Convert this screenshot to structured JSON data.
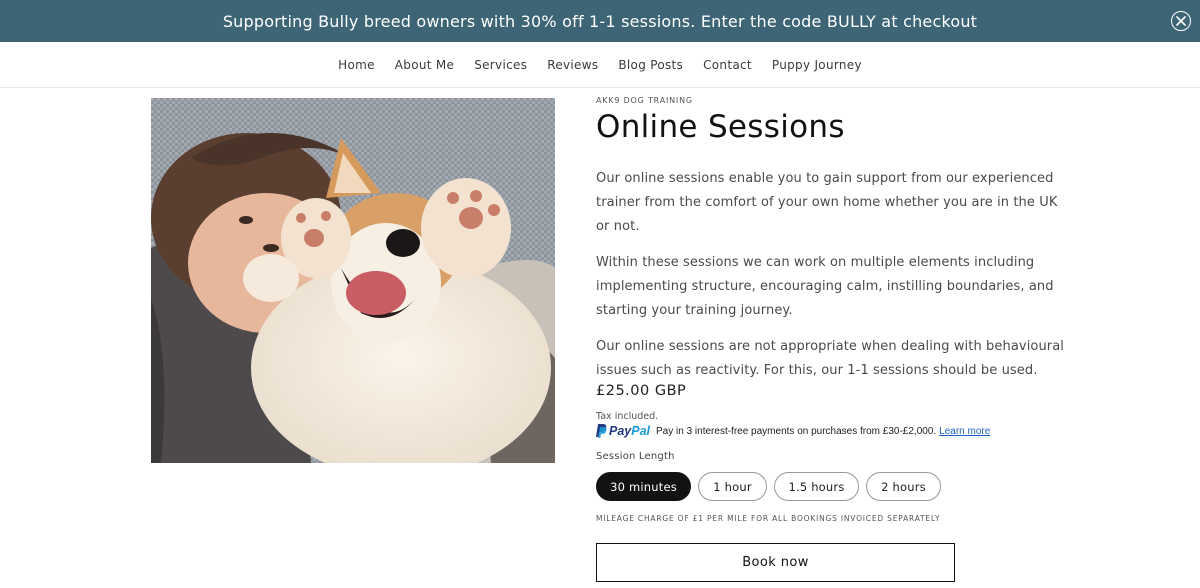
{
  "announcement": {
    "text": "Supporting Bully breed owners with 30% off 1-1 sessions. Enter the code BULLY at checkout",
    "close_icon": "close-icon",
    "background": "#3e6576"
  },
  "nav": {
    "items": [
      "Home",
      "About Me",
      "Services",
      "Reviews",
      "Blog Posts",
      "Contact",
      "Puppy Journey"
    ]
  },
  "product": {
    "image_icon": "product-photo",
    "vendor": "AKK9 DOG TRAINING",
    "title": "Online Sessions",
    "description": [
      "Our online sessions enable you to gain support from our experienced trainer from the comfort of your own home whether you are in the UK or not.",
      "Within these sessions we can work on multiple elements including implementing structure, encouraging calm, instilling boundaries, and starting your training journey.",
      "Our online sessions are not appropriate when dealing with behavioural issues such as reactivity. For this, our 1-1 sessions should be used."
    ],
    "price": "£25.00 GBP",
    "tax_note": "Tax included.",
    "paypal": {
      "brand_pay": "Pay",
      "brand_pal": "Pal",
      "message": "Pay in 3 interest-free payments on purchases from £30-£2,000.",
      "learn_more": "Learn more"
    },
    "option_label": "Session Length",
    "options": [
      "30 minutes",
      "1 hour",
      "1.5 hours",
      "2 hours"
    ],
    "selected_option": "30 minutes",
    "mileage_note": "MILEAGE CHARGE OF £1 PER MILE FOR ALL BOOKINGS INVOICED SEPARATELY",
    "book_button": "Book now"
  }
}
